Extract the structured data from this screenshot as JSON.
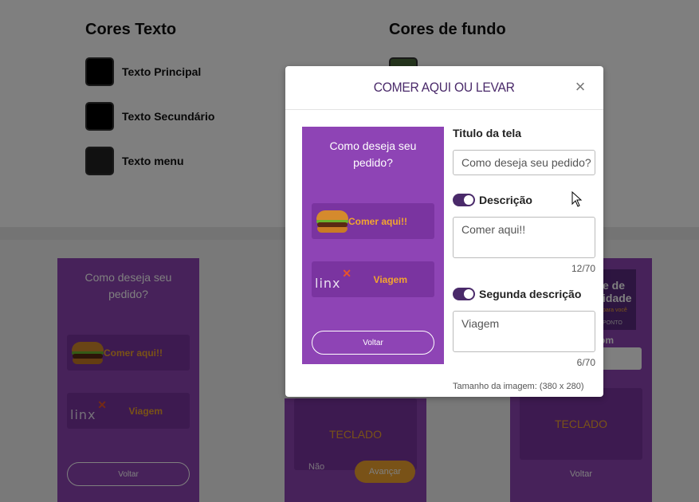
{
  "background": {
    "text_colors_title": "Cores Texto",
    "bg_colors_title": "Cores de fundo",
    "text_colors": [
      {
        "label": "Texto Principal",
        "color": "#000000"
      },
      {
        "label": "Texto Secundário",
        "color": "#000000"
      },
      {
        "label": "Texto menu",
        "color": "#222222"
      }
    ],
    "left_phone": {
      "question": "Como deseja seu pedido?",
      "option1": "Comer aqui!!",
      "option2": "Viagem",
      "logo_text": "linx",
      "back": "Voltar"
    },
    "mid_phone": {
      "keyboard": "TECLADO",
      "no": "Não",
      "next": "Avançar"
    },
    "right_phone": {
      "promo_line1": "e de",
      "promo_line2": "idade",
      "promo_small": "para você",
      "promo_sub": "PONTO",
      "label": "om",
      "keyboard": "TECLADO",
      "back": "Voltar"
    }
  },
  "modal": {
    "title": "COMER AQUI OU LEVAR",
    "close": "×",
    "preview": {
      "question": "Como deseja seu pedido?",
      "option1": "Comer aqui!!",
      "option2": "Viagem",
      "logo_text": "linx",
      "back": "Voltar"
    },
    "form": {
      "screen_title_label": "Titulo da tela",
      "screen_title_value": "Como deseja seu pedido?",
      "description_label": "Descrição",
      "description_on": true,
      "description_value": "Comer aqui!!",
      "description_counter": "12/70",
      "second_description_label": "Segunda descrição",
      "second_description_on": true,
      "second_description_value": "Viagem",
      "second_description_counter": "6/70",
      "image_size": "Tamanho da imagem: (380 x 280)"
    }
  },
  "colors": {
    "accent": "#4a2a6a",
    "preview_bg": "#8e44b5",
    "option_bg": "#7a34a0",
    "option_text": "#f3a52f"
  }
}
